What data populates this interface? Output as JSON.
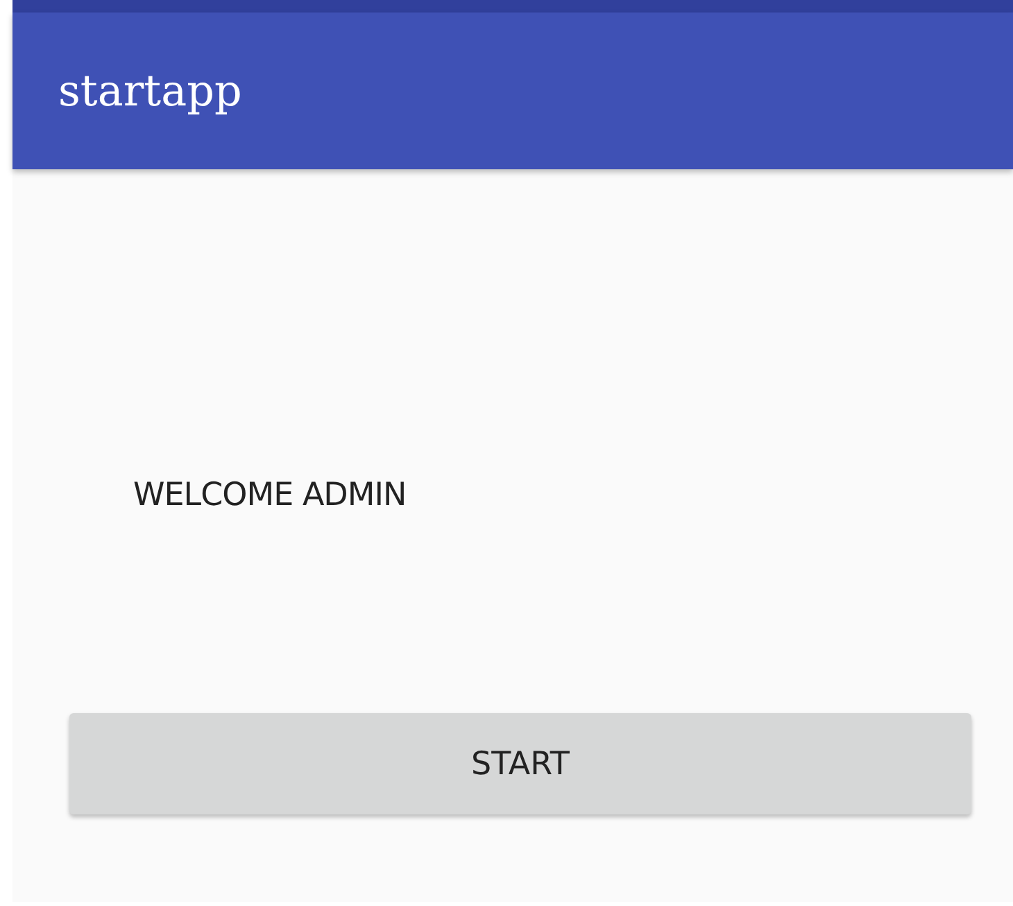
{
  "app_bar": {
    "title": "startapp"
  },
  "welcome_text": "WELCOME ADMIN",
  "start_button": {
    "label": "START"
  }
}
